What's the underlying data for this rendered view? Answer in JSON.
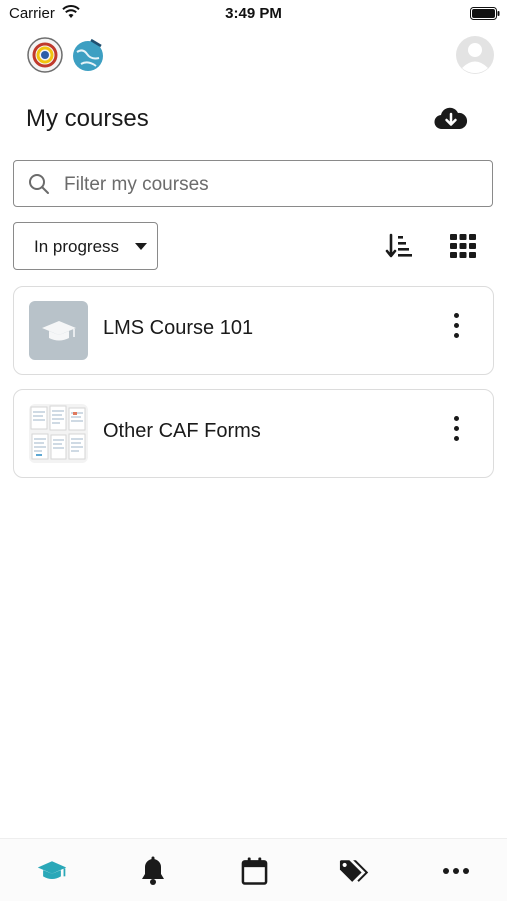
{
  "status_bar": {
    "carrier": "Carrier",
    "time": "3:49 PM"
  },
  "header": {
    "title": "My courses"
  },
  "search": {
    "placeholder": "Filter my courses",
    "value": ""
  },
  "filter": {
    "selected": "In progress"
  },
  "courses": [
    {
      "name": "LMS Course 101",
      "thumbnail": "graduation-cap-placeholder"
    },
    {
      "name": "Other CAF Forms",
      "thumbnail": "document-collage"
    }
  ],
  "tabs": [
    {
      "icon": "graduation-cap-icon",
      "active": true
    },
    {
      "icon": "bell-icon",
      "active": false
    },
    {
      "icon": "calendar-icon",
      "active": false
    },
    {
      "icon": "tags-icon",
      "active": false
    },
    {
      "icon": "more-icon",
      "active": false
    }
  ],
  "colors": {
    "accent": "#2aa8b8",
    "text": "#1a1a1a",
    "border": "#8a8a8a",
    "thumb_placeholder": "#b8c2c9"
  }
}
